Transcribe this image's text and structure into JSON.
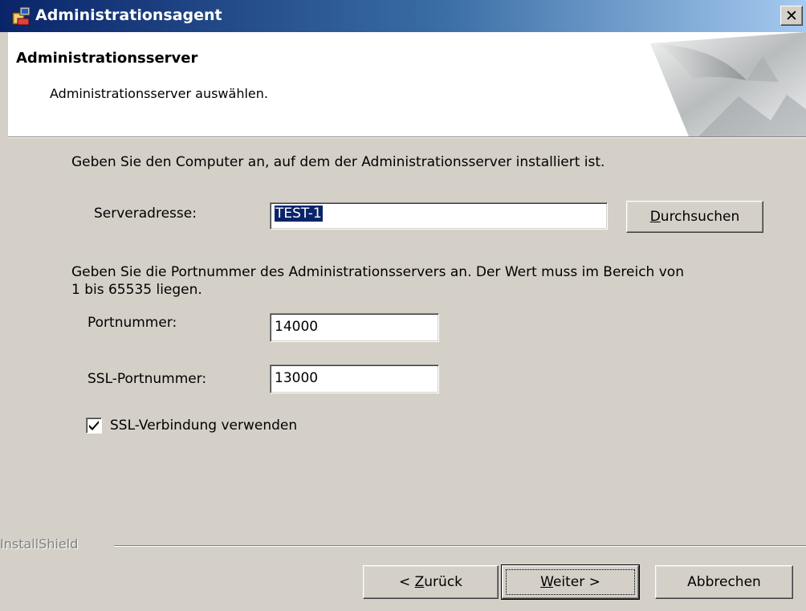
{
  "window": {
    "title": "Administrationsagent",
    "close_glyph": "✕"
  },
  "header": {
    "title": "Administrationsserver",
    "subtitle": "Administrationsserver auswählen."
  },
  "server": {
    "intro": "Geben Sie den Computer an, auf dem der Administrationsserver installiert ist.",
    "address_label": "Serveradresse:",
    "address_value": "TEST-1",
    "browse_prefix": "",
    "browse_mnemonic": "D",
    "browse_rest": "urchsuchen"
  },
  "ports": {
    "intro_line1": "Geben Sie die Portnummer des Administrationsservers an. Der Wert muss im Bereich von",
    "intro_line2": "1 bis 65535 liegen.",
    "port_label": "Portnummer:",
    "port_value": "14000",
    "ssl_port_label": "SSL-Portnummer:",
    "ssl_port_value": "13000",
    "ssl_checkbox_label": "SSL-Verbindung verwenden",
    "ssl_checked": true
  },
  "footer": {
    "brand": "InstallShield",
    "back_prefix": "< ",
    "back_mnemonic": "Z",
    "back_rest": "urück",
    "next_prefix": "",
    "next_mnemonic": "W",
    "next_rest": "eiter >",
    "cancel_label": "Abbrechen"
  }
}
